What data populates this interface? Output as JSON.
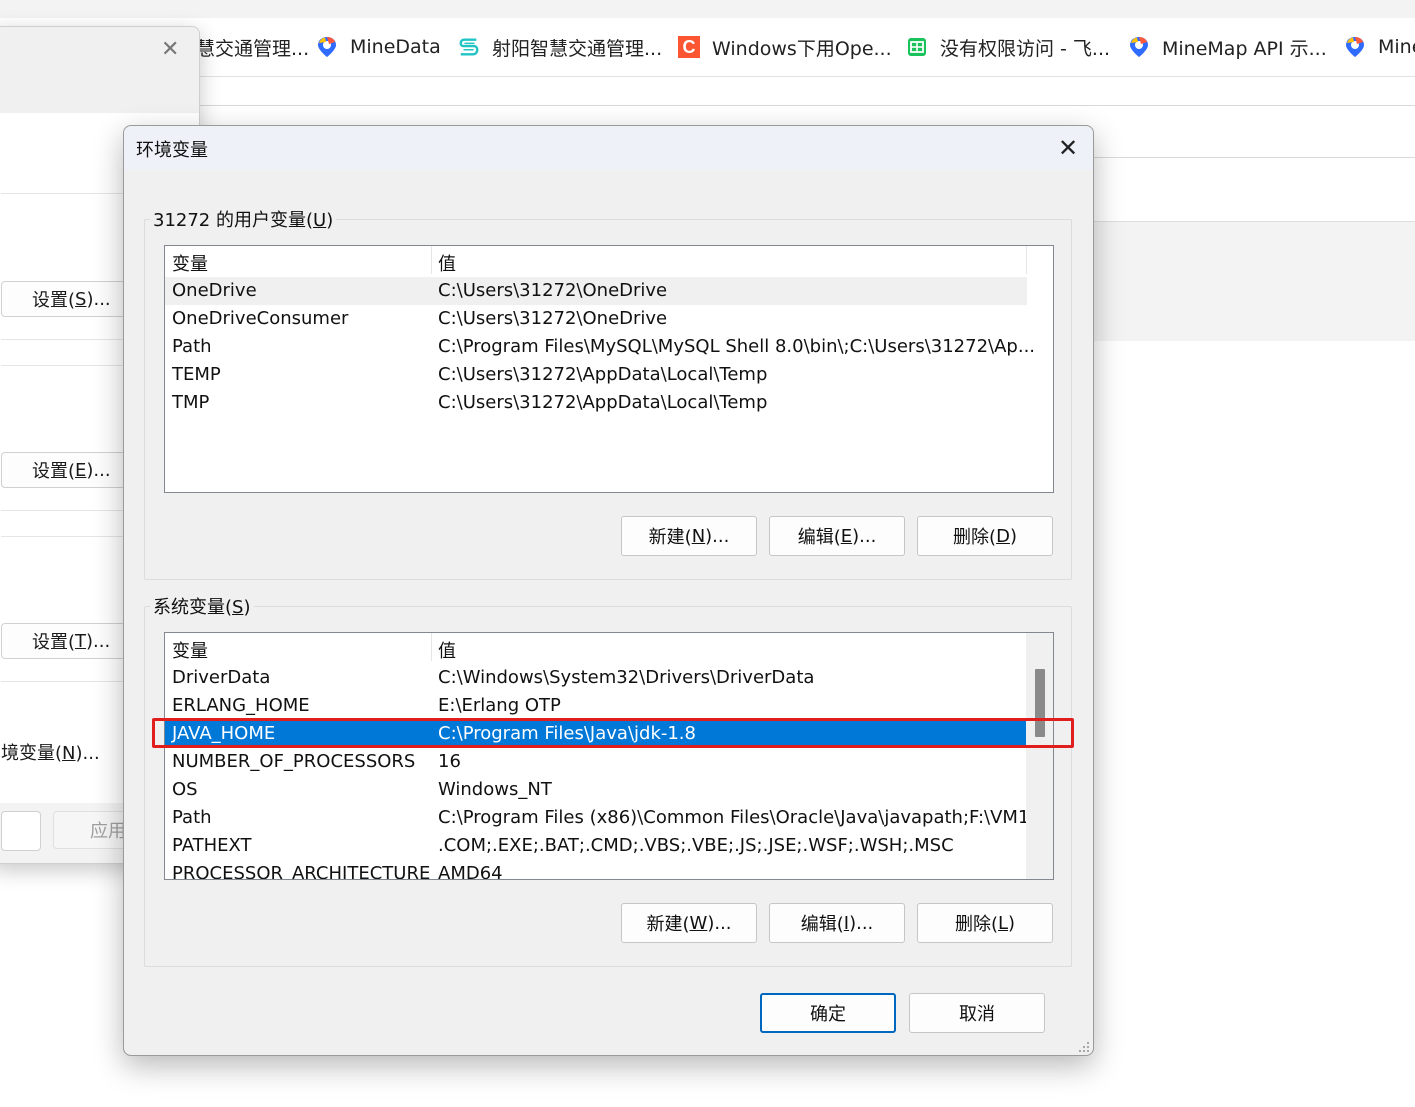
{
  "bookmarks": [
    {
      "label": "慧交通管理...",
      "icon": "blank-icon",
      "color": "#777777"
    },
    {
      "label": "MineData",
      "icon": "minemap-pin-icon",
      "color": "#2f6bff"
    },
    {
      "label": "射阳智慧交通管理...",
      "icon": "s-logo-icon",
      "color": "#20c4c4"
    },
    {
      "label": "Windows下用Ope...",
      "icon": "csdn-c-icon",
      "color": "#fc5531"
    },
    {
      "label": "没有权限访问 - 飞...",
      "icon": "feishu-sheet-icon",
      "color": "#19c25a"
    },
    {
      "label": "MineMap API 示...",
      "icon": "minemap-pin-icon",
      "color": "#2f6bff"
    },
    {
      "label": "Mine",
      "icon": "minemap-pin-icon",
      "color": "#2f6bff"
    }
  ],
  "back_window": {
    "buttons": [
      {
        "label_pre": "设置(",
        "key": "S",
        "label_post": ")..."
      },
      {
        "label_pre": "设置(",
        "key": "E",
        "label_post": ")..."
      },
      {
        "label_pre": "设置(",
        "key": "T",
        "label_post": ")..."
      }
    ],
    "env_link_pre": "境变量(",
    "env_link_key": "N",
    "env_link_post": ")...",
    "apply_label": "应用"
  },
  "dialog": {
    "title": "环境变量",
    "user_group": {
      "label_pre": "31272 的用户变量(",
      "key": "U",
      "label_post": ")"
    },
    "system_group": {
      "label_pre": "系统变量(",
      "key": "S",
      "label_post": ")"
    },
    "columns": {
      "name": "变量",
      "value": "值"
    },
    "user_vars": [
      {
        "name": "OneDrive",
        "value": "C:\\Users\\31272\\OneDrive"
      },
      {
        "name": "OneDriveConsumer",
        "value": "C:\\Users\\31272\\OneDrive"
      },
      {
        "name": "Path",
        "value": "C:\\Program Files\\MySQL\\MySQL Shell 8.0\\bin\\;C:\\Users\\31272\\Ap..."
      },
      {
        "name": "TEMP",
        "value": "C:\\Users\\31272\\AppData\\Local\\Temp"
      },
      {
        "name": "TMP",
        "value": "C:\\Users\\31272\\AppData\\Local\\Temp"
      }
    ],
    "system_vars": [
      {
        "name": "DriverData",
        "value": "C:\\Windows\\System32\\Drivers\\DriverData"
      },
      {
        "name": "ERLANG_HOME",
        "value": "E:\\Erlang OTP"
      },
      {
        "name": "JAVA_HOME",
        "value": "C:\\Program Files\\Java\\jdk-1.8"
      },
      {
        "name": "NUMBER_OF_PROCESSORS",
        "value": "16"
      },
      {
        "name": "OS",
        "value": "Windows_NT"
      },
      {
        "name": "Path",
        "value": "C:\\Program Files (x86)\\Common Files\\Oracle\\Java\\javapath;F:\\VM1..."
      },
      {
        "name": "PATHEXT",
        "value": ".COM;.EXE;.BAT;.CMD;.VBS;.VBE;.JS;.JSE;.WSF;.WSH;.MSC"
      },
      {
        "name": "PROCESSOR_ARCHITECTURE",
        "value": "AMD64"
      }
    ],
    "user_buttons": {
      "new": {
        "pre": "新建(",
        "key": "N",
        "post": ")..."
      },
      "edit": {
        "pre": "编辑(",
        "key": "E",
        "post": ")..."
      },
      "delete": {
        "pre": "删除(",
        "key": "D",
        "post": ")"
      }
    },
    "system_buttons": {
      "new": {
        "pre": "新建(",
        "key": "W",
        "post": ")..."
      },
      "edit": {
        "pre": "编辑(",
        "key": "I",
        "post": ")..."
      },
      "delete": {
        "pre": "删除(",
        "key": "L",
        "post": ")"
      }
    },
    "ok_label": "确定",
    "cancel_label": "取消"
  },
  "colors": {
    "selection": "#0078d7",
    "highlight_box": "#e01e1e",
    "primary_border": "#0067c0"
  }
}
